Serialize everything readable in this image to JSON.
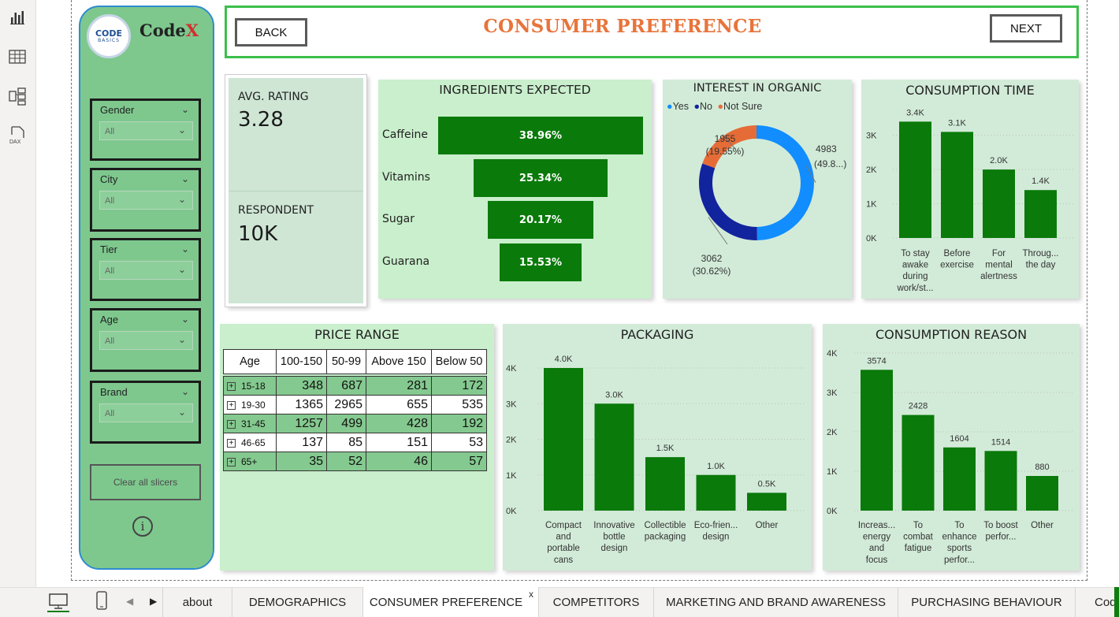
{
  "logo": {
    "badge_top": "CODE",
    "badge_bottom": "BASICS",
    "name_main": "Code",
    "name_accent": "X"
  },
  "slicers": [
    {
      "title": "Gender",
      "value": "All"
    },
    {
      "title": "City",
      "value": "All"
    },
    {
      "title": "Tier",
      "value": "All"
    },
    {
      "title": "Age",
      "value": "All"
    },
    {
      "title": "Brand",
      "value": "All"
    }
  ],
  "clear_label": "Clear all slicers",
  "info_glyph": "i",
  "header": {
    "title": "CONSUMER PREFERENCE",
    "back_label": "BACK",
    "next_label": "NEXT"
  },
  "kpis": {
    "avg_rating_label": "AVG. RATING",
    "avg_rating_value": "3.28",
    "respondent_label": "RESPONDENT",
    "respondent_value": "10K"
  },
  "colors": {
    "bar_green": "#0a7a0a",
    "donut_yes": "#118dff",
    "donut_no": "#12239e",
    "donut_not_sure": "#e66c37",
    "title_orange": "#e8743b"
  },
  "chart_data": [
    {
      "type": "bar",
      "id": "ingredients",
      "title": "INGREDIENTS EXPECTED",
      "categories": [
        "Caffeine",
        "Vitamins",
        "Sugar",
        "Guarana"
      ],
      "values": [
        38.96,
        25.34,
        20.17,
        15.53
      ],
      "labels": [
        "38.96%",
        "25.34%",
        "20.17%",
        "15.53%"
      ]
    },
    {
      "type": "pie",
      "id": "organic",
      "title": "INTEREST IN ORGANIC",
      "legend": [
        "Yes",
        "No",
        "Not Sure"
      ],
      "values": [
        4983,
        3062,
        1955
      ],
      "labels": [
        "4983",
        "3062",
        "1955"
      ],
      "pct_labels": [
        "(49.8...)",
        "(30.62%)",
        "(19.55%)"
      ]
    },
    {
      "type": "bar",
      "id": "consumption_time",
      "title": "CONSUMPTION TIME",
      "categories": [
        [
          "To stay",
          "awake",
          "during",
          "work/st..."
        ],
        [
          "Before",
          "exercise"
        ],
        [
          "For",
          "mental",
          "alertness"
        ],
        [
          "Throug...",
          "the day"
        ]
      ],
      "values": [
        3400,
        3100,
        2000,
        1400
      ],
      "labels": [
        "3.4K",
        "3.1K",
        "2.0K",
        "1.4K"
      ],
      "yticks": [
        "0K",
        "1K",
        "2K",
        "3K"
      ],
      "ylim": [
        0,
        3500
      ]
    },
    {
      "type": "table",
      "id": "price_range",
      "title": "PRICE RANGE",
      "columns": [
        "Age",
        "100-150",
        "50-99",
        "Above 150",
        "Below 50"
      ],
      "rows": [
        [
          "15-18",
          "348",
          "687",
          "281",
          "172"
        ],
        [
          "19-30",
          "1365",
          "2965",
          "655",
          "535"
        ],
        [
          "31-45",
          "1257",
          "499",
          "428",
          "192"
        ],
        [
          "46-65",
          "137",
          "85",
          "151",
          "53"
        ],
        [
          "65+",
          "35",
          "52",
          "46",
          "57"
        ]
      ]
    },
    {
      "type": "bar",
      "id": "packaging",
      "title": "PACKAGING",
      "categories": [
        [
          "Compact",
          "and",
          "portable",
          "cans"
        ],
        [
          "Innovative",
          "bottle",
          "design"
        ],
        [
          "Collectible",
          "packaging"
        ],
        [
          "Eco-frien...",
          "design"
        ],
        [
          "Other"
        ]
      ],
      "values": [
        4000,
        3000,
        1500,
        1000,
        500
      ],
      "labels": [
        "4.0K",
        "3.0K",
        "1.5K",
        "1.0K",
        "0.5K"
      ],
      "yticks": [
        "0K",
        "1K",
        "2K",
        "3K",
        "4K"
      ],
      "ylim": [
        0,
        4000
      ]
    },
    {
      "type": "bar",
      "id": "consumption_reason",
      "title": "CONSUMPTION REASON",
      "categories": [
        [
          "Increas...",
          "energy",
          "and",
          "focus"
        ],
        [
          "To",
          "combat",
          "fatigue"
        ],
        [
          "To",
          "enhance",
          "sports",
          "perfor..."
        ],
        [
          "To boost",
          "perfor..."
        ],
        [
          "Other"
        ]
      ],
      "values": [
        3574,
        2428,
        1604,
        1514,
        880
      ],
      "labels": [
        "3574",
        "2428",
        "1604",
        "1514",
        "880"
      ],
      "yticks": [
        "0K",
        "1K",
        "2K",
        "3K",
        "4K"
      ],
      "ylim": [
        0,
        4000
      ]
    }
  ],
  "tabs": [
    "about",
    "DEMOGRAPHICS",
    "CONSUMER PREFERENCE",
    "COMPETITORS",
    "MARKETING AND BRAND AWARENESS",
    "PURCHASING BEHAVIOUR",
    "Cod"
  ],
  "active_tab_close": "x"
}
